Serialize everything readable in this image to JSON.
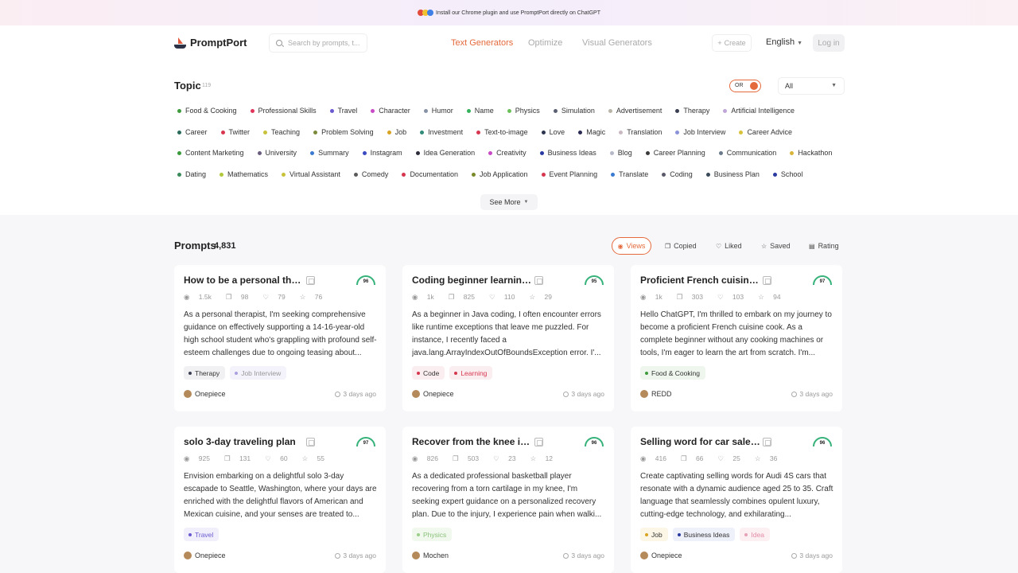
{
  "banner": {
    "text": "Install our Chrome plugin and use PromptPort directly on ChatGPT"
  },
  "header": {
    "brand": "PromptPort",
    "search_placeholder": "Search by prompts, t...",
    "nav": [
      "Text Generators",
      "Optimize",
      "Visual Generators"
    ],
    "create_label": "Create",
    "language": "English",
    "login_label": "Log in"
  },
  "topics": {
    "title": "Topic",
    "count": "119",
    "toggle_label": "OR",
    "filter_value": "All",
    "see_more": "See More",
    "rows": [
      [
        {
          "label": "Food & Cooking",
          "color": "#3d9a3d"
        },
        {
          "label": "Professional Skills",
          "color": "#e0345b"
        },
        {
          "label": "Travel",
          "color": "#6a5ad0"
        },
        {
          "label": "Character",
          "color": "#c94ac6"
        },
        {
          "label": "Humor",
          "color": "#8892a6"
        },
        {
          "label": "Name",
          "color": "#36b25c"
        },
        {
          "label": "Physics",
          "color": "#6cc05a"
        },
        {
          "label": "Simulation",
          "color": "#5a6072"
        },
        {
          "label": "Advertisement",
          "color": "#b8b4a8"
        },
        {
          "label": "Therapy",
          "color": "#3b3f52"
        },
        {
          "label": "Artificial Intelligence",
          "color": "#bfa6d8"
        }
      ],
      [
        {
          "label": "Career",
          "color": "#2a6a5a"
        },
        {
          "label": "Twitter",
          "color": "#d6374f"
        },
        {
          "label": "Teaching",
          "color": "#c8c23a"
        },
        {
          "label": "Problem Solving",
          "color": "#7a8a3a"
        },
        {
          "label": "Job",
          "color": "#d9a321"
        },
        {
          "label": "Investment",
          "color": "#2f8a7a"
        },
        {
          "label": "Text-to-image",
          "color": "#d6374f"
        },
        {
          "label": "Love",
          "color": "#2c3450"
        },
        {
          "label": "Magic",
          "color": "#2a2a55"
        },
        {
          "label": "Translation",
          "color": "#c9b8c2"
        },
        {
          "label": "Job Interview",
          "color": "#8a92d8"
        },
        {
          "label": "Career Advice",
          "color": "#d8c23a"
        }
      ],
      [
        {
          "label": "Content Marketing",
          "color": "#3a9a3a"
        },
        {
          "label": "University",
          "color": "#6a5d7e"
        },
        {
          "label": "Summary",
          "color": "#3a7ad0"
        },
        {
          "label": "Instagram",
          "color": "#3a4ac0"
        },
        {
          "label": "Idea Generation",
          "color": "#2c2c3a"
        },
        {
          "label": "Creativity",
          "color": "#c94ac6"
        },
        {
          "label": "Business Ideas",
          "color": "#2a3aa0"
        },
        {
          "label": "Blog",
          "color": "#b4b8c8"
        },
        {
          "label": "Career Planning",
          "color": "#3a3a3a"
        },
        {
          "label": "Communication",
          "color": "#6a7a8a"
        },
        {
          "label": "Hackathon",
          "color": "#d9b43a"
        }
      ],
      [
        {
          "label": "Dating",
          "color": "#3a8a5a"
        },
        {
          "label": "Mathematics",
          "color": "#b0c83a"
        },
        {
          "label": "Virtual Assistant",
          "color": "#c8c23a"
        },
        {
          "label": "Comedy",
          "color": "#5a5a5a"
        },
        {
          "label": "Documentation",
          "color": "#d6374f"
        },
        {
          "label": "Job Application",
          "color": "#7a8a2a"
        },
        {
          "label": "Event Planning",
          "color": "#d6374f"
        },
        {
          "label": "Translate",
          "color": "#3a7ad0"
        },
        {
          "label": "Coding",
          "color": "#5a5a6a"
        },
        {
          "label": "Business Plan",
          "color": "#3a4a5a"
        },
        {
          "label": "School",
          "color": "#2a3aa0"
        }
      ]
    ]
  },
  "prompts": {
    "title": "Prompts",
    "count": "4,831",
    "sort": [
      "Views",
      "Copied",
      "Liked",
      "Saved",
      "Rating"
    ],
    "cards": [
      {
        "title": "How to be a personal thera...",
        "score": "96",
        "views": "1.5k",
        "copied": "98",
        "liked": "79",
        "saved": "76",
        "description": "As a personal therapist, I'm seeking comprehensive guidance on effectively supporting a 14-16-year-old high school student who's grappling with profound self-esteem challenges due to ongoing teasing about...",
        "tags": [
          {
            "label": "Therapy",
            "dot": "#3b3f52",
            "bg": "#f1f1f3",
            "fg": "#333"
          },
          {
            "label": "Job Interview",
            "dot": "#a9a0e0",
            "bg": "#f4f3fb",
            "fg": "#999"
          }
        ],
        "author": "Onepiece",
        "date": "3 days ago"
      },
      {
        "title": "Coding beginner learning (...",
        "score": "95",
        "views": "1k",
        "copied": "825",
        "liked": "110",
        "saved": "29",
        "description": "As a beginner in Java coding, I often encounter errors like runtime exceptions that leave me puzzled. For instance, I recently faced a java.lang.ArrayIndexOutOfBoundsException error. I'...",
        "tags": [
          {
            "label": "Code",
            "dot": "#d6374f",
            "bg": "#fbeef0",
            "fg": "#333"
          },
          {
            "label": "Learning",
            "dot": "#d6374f",
            "bg": "#fbeef0",
            "fg": "#d6374f"
          }
        ],
        "author": "Onepiece",
        "date": "3 days ago"
      },
      {
        "title": "Proficient French cuisine c...",
        "score": "97",
        "views": "1k",
        "copied": "303",
        "liked": "103",
        "saved": "94",
        "description": "Hello ChatGPT, I'm thrilled to embark on my journey to become a proficient French cuisine cook. As a complete beginner without any cooking machines or tools, I'm eager to learn the art from scratch. I'm...",
        "tags": [
          {
            "label": "Food & Cooking",
            "dot": "#3d9a3d",
            "bg": "#eef6ee",
            "fg": "#333"
          }
        ],
        "author": "REDD",
        "date": "3 days ago"
      },
      {
        "title": "solo 3-day traveling plan",
        "score": "97",
        "views": "925",
        "copied": "131",
        "liked": "60",
        "saved": "55",
        "description": "Envision embarking on a delightful solo 3-day escapade to Seattle, Washington, where your days are enriched with the delightful flavors of American and Mexican cuisine, and your senses are treated to...",
        "tags": [
          {
            "label": "Travel",
            "dot": "#6a5ad0",
            "bg": "#f1effb",
            "fg": "#6a5ad0"
          }
        ],
        "author": "Onepiece",
        "date": "3 days ago"
      },
      {
        "title": "Recover from the knee injury.",
        "score": "96",
        "views": "826",
        "copied": "503",
        "liked": "23",
        "saved": "12",
        "description": "As a dedicated professional basketball player recovering from a torn cartilage in my knee, I'm seeking expert guidance on a personalized recovery plan. Due to the injury, I experience pain when walki...",
        "tags": [
          {
            "label": "Physics",
            "dot": "#9bd08a",
            "bg": "#f1f8ee",
            "fg": "#8ac27a"
          }
        ],
        "author": "Mochen",
        "date": "3 days ago"
      },
      {
        "title": "Selling word for car sales p...",
        "score": "96",
        "views": "416",
        "copied": "66",
        "liked": "25",
        "saved": "36",
        "description": "Create captivating selling words for Audi 4S cars that resonate with a dynamic audience aged 25 to 35. Craft language that seamlessly combines opulent luxury, cutting-edge technology, and exhilarating...",
        "tags": [
          {
            "label": "Job",
            "dot": "#d9a321",
            "bg": "#fcf6e6",
            "fg": "#333"
          },
          {
            "label": "Business Ideas",
            "dot": "#2a3aa0",
            "bg": "#eef0fa",
            "fg": "#333"
          },
          {
            "label": "Idea",
            "dot": "#e8a0b4",
            "bg": "#fcf0f3",
            "fg": "#e48aa4"
          }
        ],
        "author": "Onepiece",
        "date": "3 days ago"
      }
    ]
  },
  "colors": {
    "accent": "#e46a3c",
    "gauge": "#36b27a"
  }
}
